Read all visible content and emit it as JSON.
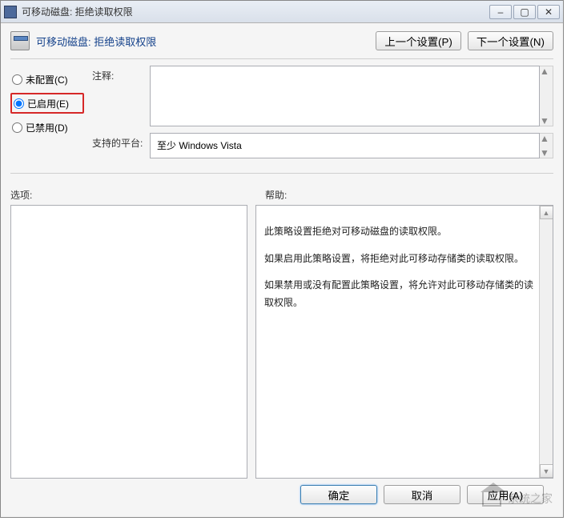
{
  "window": {
    "title": "可移动磁盘: 拒绝读取权限",
    "minimize": "‒",
    "maximize": "▢",
    "close": "✕"
  },
  "header": {
    "title": "可移动磁盘: 拒绝读取权限",
    "prev": "上一个设置(P)",
    "next": "下一个设置(N)"
  },
  "radios": {
    "not_configured": "未配置(C)",
    "enabled": "已启用(E)",
    "disabled": "已禁用(D)"
  },
  "fields": {
    "comment_label": "注释:",
    "comment_value": "",
    "platform_label": "支持的平台:",
    "platform_value": "至少 Windows Vista"
  },
  "labels": {
    "options": "选项:",
    "help": "帮助:"
  },
  "help": {
    "p1": "此策略设置拒绝对可移动磁盘的读取权限。",
    "p2": "如果启用此策略设置，将拒绝对此可移动存储类的读取权限。",
    "p3": "如果禁用或没有配置此策略设置，将允许对此可移动存储类的读取权限。"
  },
  "footer": {
    "ok": "确定",
    "cancel": "取消",
    "apply": "应用(A)"
  },
  "watermark": "系统之家"
}
